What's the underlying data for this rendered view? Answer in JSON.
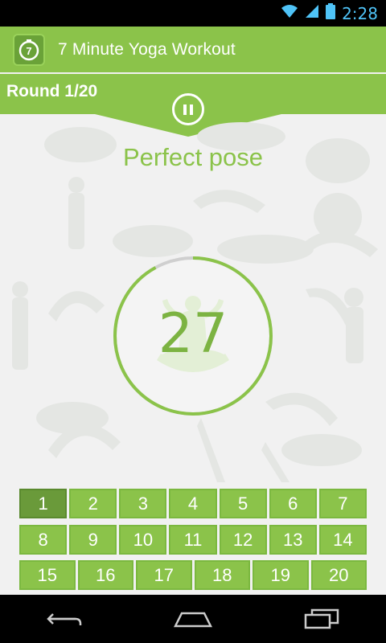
{
  "status_bar": {
    "time": "2:28",
    "icons": [
      "wifi-icon",
      "signal-icon",
      "battery-icon"
    ]
  },
  "action_bar": {
    "title": "7 Minute Yoga Workout",
    "app_icon": "stopwatch-7-icon"
  },
  "round": {
    "label": "Round 1/20",
    "current": 1,
    "total": 20
  },
  "pause": {
    "icon": "pause-icon"
  },
  "pose": {
    "name": "Perfect pose",
    "icon": "lotus-meditation-icon"
  },
  "timer": {
    "seconds": "27",
    "progress": 0.92
  },
  "rounds_grid": {
    "row1": [
      "1",
      "2",
      "3",
      "4",
      "5",
      "6",
      "7"
    ],
    "row2": [
      "8",
      "9",
      "10",
      "11",
      "12",
      "13",
      "14"
    ],
    "row3": [
      "15",
      "16",
      "17",
      "18",
      "19",
      "20"
    ]
  },
  "nav": {
    "back": "back-icon",
    "home": "home-icon",
    "recents": "recents-icon"
  },
  "colors": {
    "accent": "#8bc34a",
    "accent_dark": "#6a9a3a",
    "background": "#f1f1f1"
  }
}
